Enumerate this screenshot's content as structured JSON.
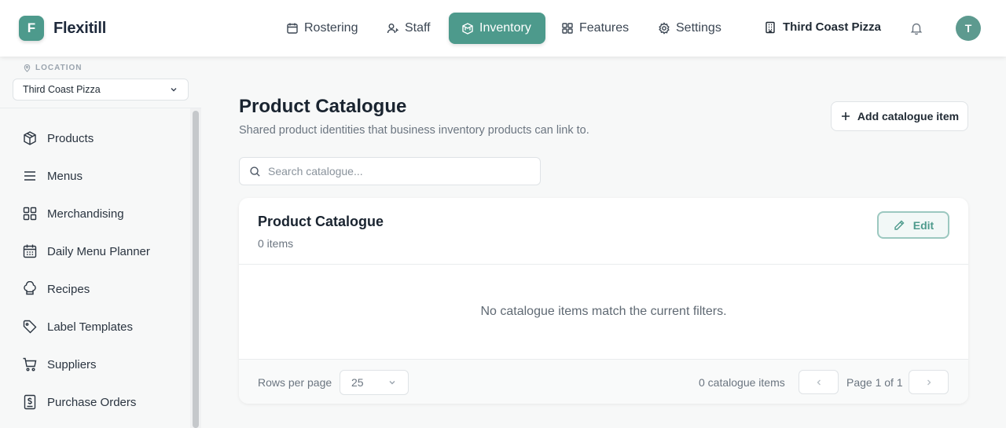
{
  "header": {
    "logo_letter": "F",
    "brand": "Flexitill",
    "nav": [
      {
        "label": "Rostering",
        "icon": "calendar-icon"
      },
      {
        "label": "Staff",
        "icon": "user-icon"
      },
      {
        "label": "Inventory",
        "icon": "box-icon",
        "active": true
      },
      {
        "label": "Features",
        "icon": "grid-icon"
      },
      {
        "label": "Settings",
        "icon": "gear-icon"
      }
    ],
    "business_name": "Third Coast Pizza",
    "avatar_initial": "T"
  },
  "sidebar": {
    "location_label": "LOCATION",
    "location_value": "Third Coast Pizza",
    "items": [
      {
        "label": "Products",
        "icon": "package-icon"
      },
      {
        "label": "Menus",
        "icon": "menu-lines-icon"
      },
      {
        "label": "Merchandising",
        "icon": "grid-icon"
      },
      {
        "label": "Daily Menu Planner",
        "icon": "calendar-icon"
      },
      {
        "label": "Recipes",
        "icon": "chef-hat-icon"
      },
      {
        "label": "Label Templates",
        "icon": "tag-icon"
      },
      {
        "label": "Suppliers",
        "icon": "cart-icon"
      },
      {
        "label": "Purchase Orders",
        "icon": "receipt-icon"
      }
    ]
  },
  "main": {
    "title": "Product Catalogue",
    "subtitle": "Shared product identities that business inventory products can link to.",
    "add_button": "Add catalogue item",
    "search_placeholder": "Search catalogue...",
    "card": {
      "title": "Product Catalogue",
      "count": "0 items",
      "edit_label": "Edit",
      "empty_message": "No catalogue items match the current filters.",
      "rows_per_page_label": "Rows per page",
      "rows_per_page_value": "25",
      "total_count": "0 catalogue items",
      "page_label": "Page 1 of 1"
    }
  },
  "colors": {
    "accent": "#4d9a8c",
    "background": "#f7f8f8",
    "text": "#1f2933",
    "muted": "#6b7580"
  }
}
